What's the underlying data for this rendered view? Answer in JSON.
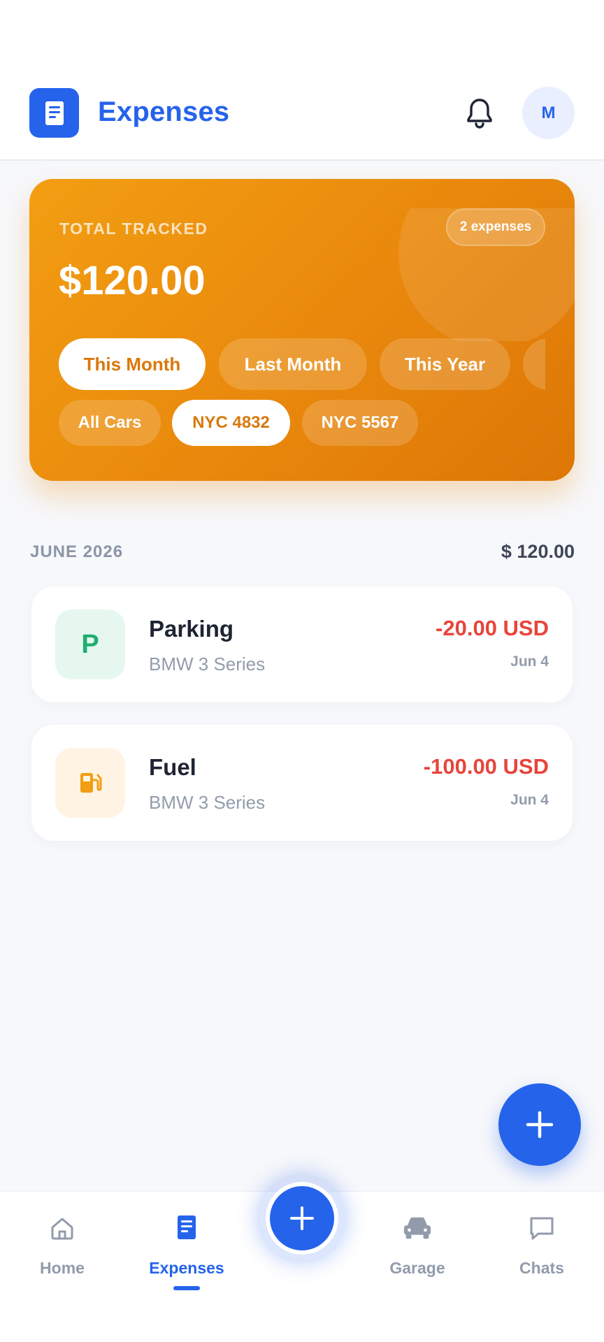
{
  "header": {
    "title": "Expenses",
    "avatar_initial": "M"
  },
  "summary": {
    "label": "TOTAL TRACKED",
    "total": "$120.00",
    "count_badge": "2 expenses",
    "periods": [
      {
        "label": "This Month",
        "active": true
      },
      {
        "label": "Last Month",
        "active": false
      },
      {
        "label": "This Year",
        "active": false
      }
    ],
    "cars": [
      {
        "label": "All Cars",
        "active": false
      },
      {
        "label": "NYC 4832",
        "active": true
      },
      {
        "label": "NYC 5567",
        "active": false
      }
    ]
  },
  "month": {
    "label": "JUNE 2026",
    "total": "$ 120.00"
  },
  "expenses": [
    {
      "title": "Parking",
      "vehicle": "BMW 3 Series",
      "amount": "-20.00 USD",
      "date": "Jun 4",
      "icon": "parking-icon",
      "icon_text": "P",
      "icon_bg": "#e6f7f0",
      "icon_color": "#1fae6e"
    },
    {
      "title": "Fuel",
      "vehicle": "BMW 3 Series",
      "amount": "-100.00 USD",
      "date": "Jun 4",
      "icon": "fuel-pump-icon",
      "icon_bg": "#fff3e3",
      "icon_color": "#f29e12"
    }
  ],
  "nav": {
    "items": [
      {
        "label": "Home",
        "icon": "home-icon",
        "active": false
      },
      {
        "label": "Expenses",
        "icon": "receipt-icon",
        "active": true
      },
      {
        "label": "Garage",
        "icon": "car-icon",
        "active": false
      },
      {
        "label": "Chats",
        "icon": "chat-icon",
        "active": false
      }
    ]
  },
  "colors": {
    "primary": "#2563eb",
    "card_orange": "#ea8a0d",
    "negative": "#e8443b"
  }
}
